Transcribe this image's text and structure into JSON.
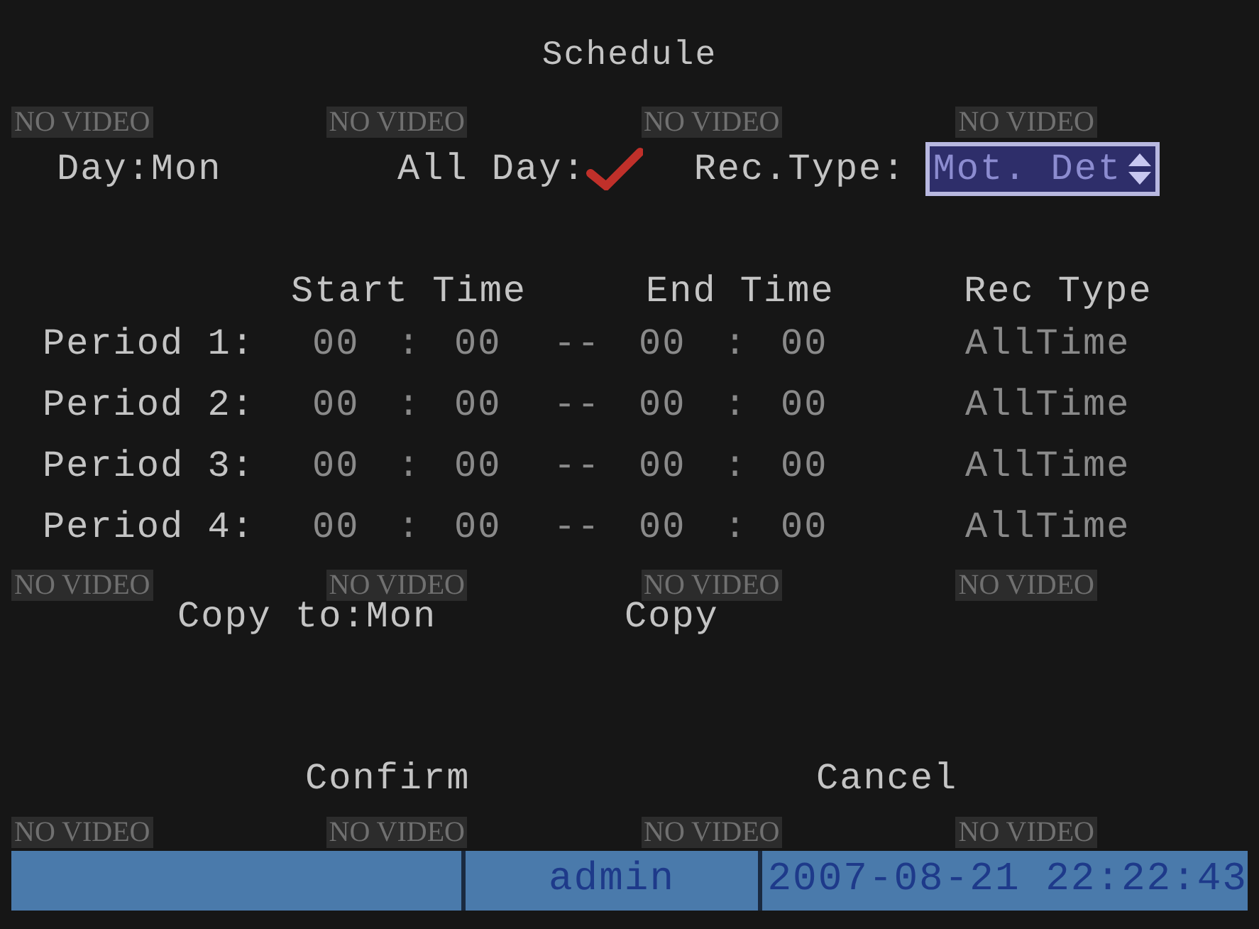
{
  "camera_tiles": [
    "NO VIDEO",
    "NO VIDEO",
    "NO VIDEO",
    "NO VIDEO",
    "NO VIDEO",
    "NO VIDEO",
    "NO VIDEO",
    "NO VIDEO",
    "NO VIDEO",
    "NO VIDEO",
    "NO VIDEO",
    "NO VIDEO"
  ],
  "title": "Schedule",
  "day": {
    "label": "Day:",
    "value": "Mon"
  },
  "all_day": {
    "label": "All Day:",
    "checked": true
  },
  "rec_type": {
    "label": "Rec.Type:",
    "value": "Mot. Det"
  },
  "columns": [
    "Start Time",
    "End Time",
    "Rec Type"
  ],
  "periods": [
    {
      "label": "Period 1:",
      "start_hour": "00",
      "start_sep": ":",
      "start_min": "00",
      "dash": "--",
      "end_hour": "00",
      "end_sep": ":",
      "end_min": "00",
      "rec_type": "AllTime"
    },
    {
      "label": "Period 2:",
      "start_hour": "00",
      "start_sep": ":",
      "start_min": "00",
      "dash": "--",
      "end_hour": "00",
      "end_sep": ":",
      "end_min": "00",
      "rec_type": "AllTime"
    },
    {
      "label": "Period 3:",
      "start_hour": "00",
      "start_sep": ":",
      "start_min": "00",
      "dash": "--",
      "end_hour": "00",
      "end_sep": ":",
      "end_min": "00",
      "rec_type": "AllTime"
    },
    {
      "label": "Period 4:",
      "start_hour": "00",
      "start_sep": ":",
      "start_min": "00",
      "dash": "--",
      "end_hour": "00",
      "end_sep": ":",
      "end_min": "00",
      "rec_type": "AllTime"
    }
  ],
  "copy": {
    "label": "Copy to:",
    "value": "Mon",
    "button": "Copy"
  },
  "buttons": [
    "Confirm",
    "Cancel"
  ],
  "status_bar": {
    "user": "admin",
    "datetime": "2007-08-21 22:22:43"
  }
}
